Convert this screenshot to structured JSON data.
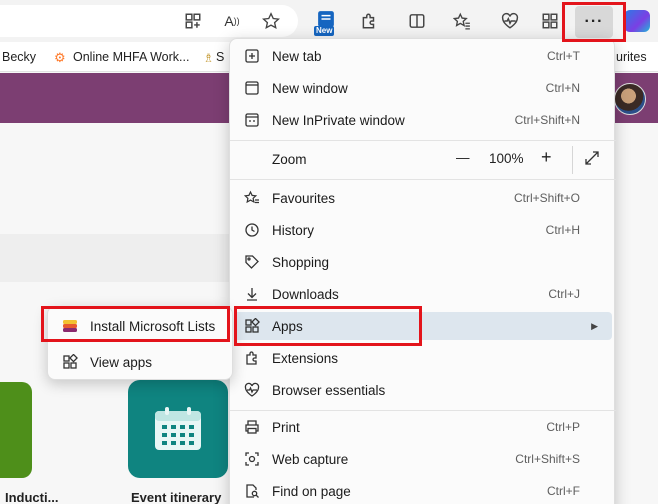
{
  "bookmarks": [
    {
      "label": "Becky"
    },
    {
      "label": "Online MHFA Work..."
    },
    {
      "label": "S"
    },
    {
      "label": "urites"
    }
  ],
  "toolbar": {
    "new_badge": "New",
    "more_label": "···"
  },
  "menu": {
    "items": [
      {
        "label": "New tab",
        "shortcut": "Ctrl+T",
        "icon": "new-tab-icon"
      },
      {
        "label": "New window",
        "shortcut": "Ctrl+N",
        "icon": "window-icon"
      },
      {
        "label": "New InPrivate window",
        "shortcut": "Ctrl+Shift+N",
        "icon": "inprivate-icon"
      },
      {
        "label": "Favourites",
        "shortcut": "Ctrl+Shift+O",
        "icon": "favourites-icon"
      },
      {
        "label": "History",
        "shortcut": "Ctrl+H",
        "icon": "history-icon"
      },
      {
        "label": "Shopping",
        "shortcut": "",
        "icon": "tag-icon"
      },
      {
        "label": "Downloads",
        "shortcut": "Ctrl+J",
        "icon": "download-icon"
      },
      {
        "label": "Apps",
        "shortcut": "",
        "icon": "apps-icon"
      },
      {
        "label": "Extensions",
        "shortcut": "",
        "icon": "puzzle-icon"
      },
      {
        "label": "Browser essentials",
        "shortcut": "",
        "icon": "heart-pulse-icon"
      },
      {
        "label": "Print",
        "shortcut": "Ctrl+P",
        "icon": "printer-icon"
      },
      {
        "label": "Web capture",
        "shortcut": "Ctrl+Shift+S",
        "icon": "capture-icon"
      },
      {
        "label": "Find on page",
        "shortcut": "Ctrl+F",
        "icon": "search-doc-icon"
      }
    ],
    "zoom": {
      "label": "Zoom",
      "minus": "—",
      "value": "100%",
      "plus": "+",
      "fullscreen_icon": "expand-icon"
    },
    "highlighted_item": "Apps",
    "highlight_color": "#dde6ee"
  },
  "submenu": {
    "items": [
      {
        "label": "Install Microsoft Lists",
        "icon": "microsoft-lists-icon"
      },
      {
        "label": "View apps",
        "icon": "apps-icon"
      }
    ]
  },
  "page": {
    "tiles": [
      {
        "label": "Inducti..."
      },
      {
        "label": "Event itinerary"
      }
    ],
    "accent_color": "#7c3e72"
  },
  "colors": {
    "highlight_box": "#e3141b"
  }
}
